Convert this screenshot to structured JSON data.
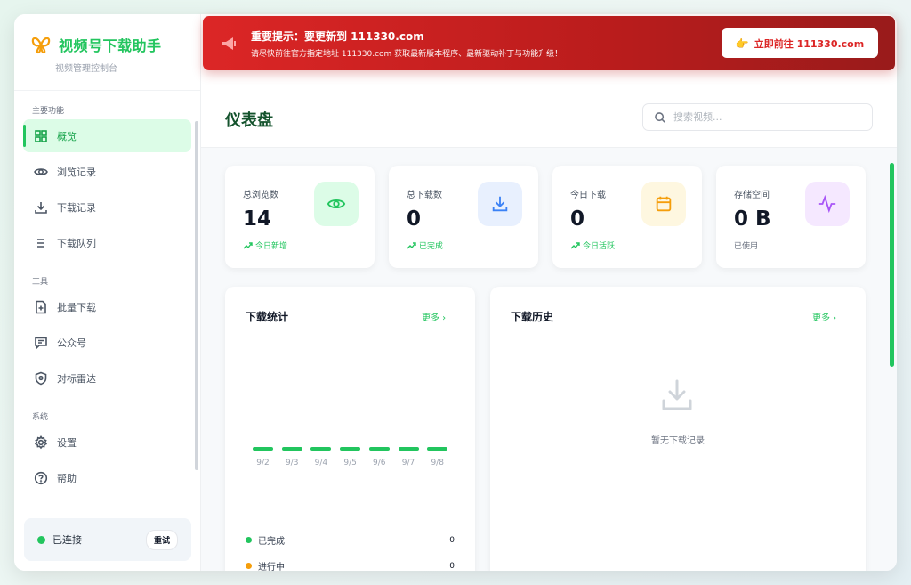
{
  "brand": {
    "title": "视频号下载助手",
    "subtitle": "视频管理控制台"
  },
  "nav": {
    "main_label": "主要功能",
    "main_items": [
      {
        "label": "概览",
        "icon": "grid-icon",
        "active": true
      },
      {
        "label": "浏览记录",
        "icon": "eye-icon"
      },
      {
        "label": "下载记录",
        "icon": "download-icon"
      },
      {
        "label": "下载队列",
        "icon": "list-icon"
      }
    ],
    "tools_label": "工具",
    "tools_items": [
      {
        "label": "批量下载",
        "icon": "file-plus-icon"
      },
      {
        "label": "公众号",
        "icon": "message-icon"
      },
      {
        "label": "对标雷达",
        "icon": "shield-icon"
      }
    ],
    "system_label": "系统",
    "system_items": [
      {
        "label": "设置",
        "icon": "gear-icon"
      },
      {
        "label": "帮助",
        "icon": "help-icon"
      }
    ]
  },
  "connection": {
    "status": "已连接",
    "retry": "重试",
    "color": "#22c55e"
  },
  "banner": {
    "title": "重要提示：要更新到 111330.com",
    "text": "请尽快前往官方指定地址 111330.com 获取最新版本程序、最新驱动补丁与功能升级！",
    "button": "立即前往 111330.com",
    "hand": "👉"
  },
  "header": {
    "title": "仪表盘",
    "search_placeholder": "搜索视频..."
  },
  "stats": [
    {
      "label": "总浏览数",
      "value": "14",
      "sub": "今日新增",
      "icon": "eye-icon",
      "color": "#22c55e"
    },
    {
      "label": "总下载数",
      "value": "0",
      "sub": "已完成",
      "icon": "download-icon",
      "color": "#3b82f6"
    },
    {
      "label": "今日下载",
      "value": "0",
      "sub": "今日活跃",
      "icon": "calendar-icon",
      "color": "#f59e0b"
    },
    {
      "label": "存储空间",
      "value": "0 B",
      "sub": "已使用",
      "icon": "activity-icon",
      "color": "#a855f7"
    }
  ],
  "download_stats": {
    "title": "下载统计",
    "more": "更多",
    "legend": [
      {
        "label": "已完成",
        "value": "0",
        "color": "#22c55e"
      },
      {
        "label": "进行中",
        "value": "0",
        "color": "#f59e0b"
      }
    ]
  },
  "chart_data": {
    "type": "bar",
    "categories": [
      "9/2",
      "9/3",
      "9/4",
      "9/5",
      "9/6",
      "9/7",
      "9/8"
    ],
    "values": [
      0,
      0,
      0,
      0,
      0,
      0,
      0
    ]
  },
  "history": {
    "title": "下载历史",
    "more": "更多",
    "empty": "暂无下载记录"
  }
}
